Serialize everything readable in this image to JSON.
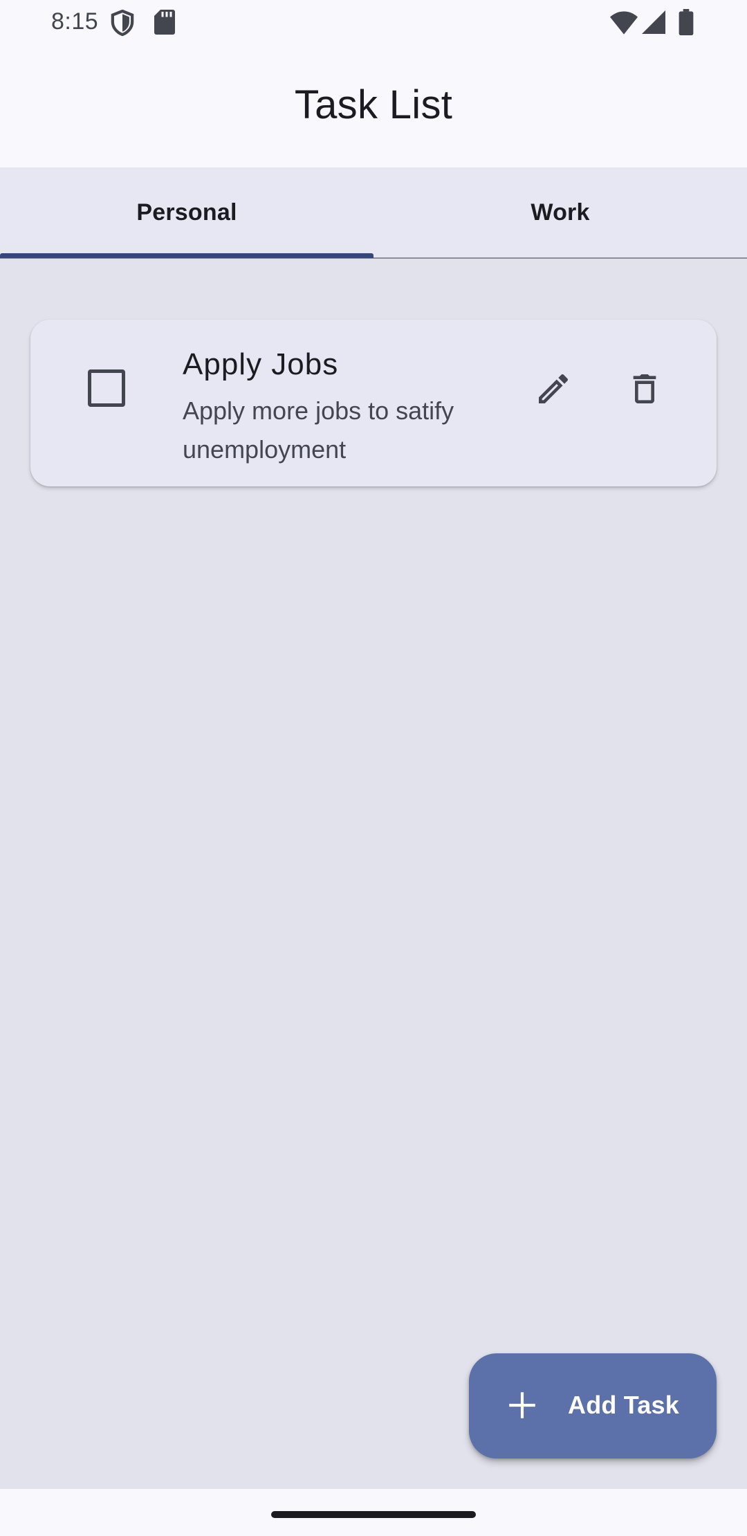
{
  "status_bar": {
    "time": "8:15",
    "icons": [
      "shield-icon",
      "sd-card-icon",
      "wifi-icon",
      "cell-signal-icon",
      "battery-icon"
    ]
  },
  "app_bar": {
    "title": "Task List"
  },
  "tabs": [
    {
      "label": "Personal",
      "selected": true
    },
    {
      "label": "Work",
      "selected": false
    }
  ],
  "tasks": [
    {
      "title": "Apply Jobs",
      "description": "Apply more jobs to satify unemployment",
      "checked": false,
      "actions": [
        "pencil-icon",
        "trash-icon"
      ]
    }
  ],
  "fab": {
    "label": "Add Task",
    "icon": "plus-icon"
  },
  "colors": {
    "background": "#e1e2ec",
    "app_bar": "#f8f8fd",
    "tab_indicator": "#34467a",
    "fab": "#5c70a9",
    "card": "#e6e7f3"
  }
}
